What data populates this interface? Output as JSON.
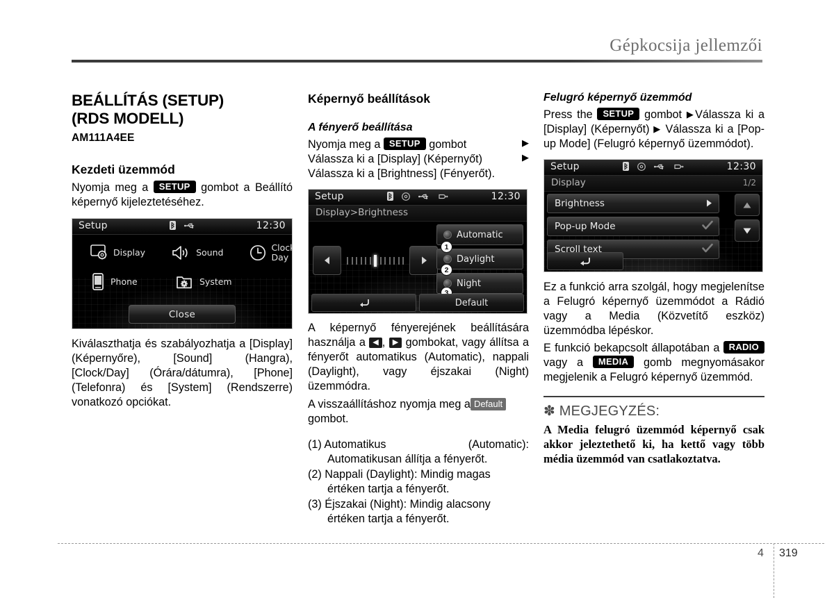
{
  "header": {
    "title": "Gépkocsija jellemzői"
  },
  "footer": {
    "chapter": "4",
    "page": "319"
  },
  "left": {
    "section_title_line1": "BEÁLLÍTÁS (SETUP)",
    "section_title_line2": "(RDS MODELL)",
    "code": "AM111A4EE",
    "subtitle": "Kezdeti üzemmód",
    "intro_before": "Nyomja meg a",
    "intro_pill": "SETUP",
    "intro_after": "gombot a Beállító képernyő kijeleztetéséhez.",
    "caption": "Kiválaszthatja és szabályozhatja a [Display] (Képernyőre), [Sound] (Hangra), [Clock/Day] (Órára/dátumra), [Phone] (Telefonra) és [System] (Rendszerre) vonatkozó opciókat.",
    "device": {
      "status_title": "Setup",
      "clock": "12:30",
      "icons": [
        "bluetooth-icon",
        "usb-icon"
      ],
      "menu": [
        {
          "label_line1": "Display",
          "label_line2": "",
          "icon": "display-gear-icon"
        },
        {
          "label_line1": "Sound",
          "label_line2": "",
          "icon": "speaker-icon"
        },
        {
          "label_line1": "Clock/",
          "label_line2": "Day",
          "icon": "clock-icon"
        },
        {
          "label_line1": "Phone",
          "label_line2": "",
          "icon": "phone-icon"
        },
        {
          "label_line1": "System",
          "label_line2": "",
          "icon": "folder-gear-icon"
        }
      ],
      "close_label": "Close"
    }
  },
  "mid": {
    "subtitle": "Képernyő beállítások",
    "italic_title": "A fényerő beállítása",
    "step_pre": "Nyomja meg a",
    "step_pill": "SETUP",
    "step_post": "gombot",
    "step2": "Válassza ki a [Display] (Képernyőt)",
    "step3": "Válassza ki a [Brightness] (Fényerőt).",
    "para1_a": "A képernyő fényerejének beállítására használja a",
    "para1_b": ",",
    "para1_c": "gombokat, vagy állítsa a fényerőt automatikus (Automatic), nappali (Daylight), vagy éjszakai (Night) üzemmódra.",
    "para2_a": "A visszaállításhoz nyomja meg a",
    "para2_pill": "Default",
    "para2_b": "gombot.",
    "list": [
      {
        "num": "(1)",
        "label": "Automatikus",
        "en": "(Automatic):",
        "desc": "Automatikusan állítja a fényerőt."
      },
      {
        "num": "(2)",
        "label": "Nappali (Daylight): Mindig magas",
        "en": "",
        "desc": "értéken tartja a fényerőt."
      },
      {
        "num": "(3)",
        "label": "Éjszakai (Night): Mindig alacsony",
        "en": "",
        "desc": "értéken tartja a fényerőt."
      }
    ],
    "device": {
      "status_title": "Setup",
      "clock": "12:30",
      "icons": [
        "bluetooth-icon",
        "disc-icon",
        "usb-icon",
        "aux-icon"
      ],
      "breadcrumb": "Display>Brightness",
      "options": [
        {
          "label": "Automatic",
          "callout": "1"
        },
        {
          "label": "Daylight",
          "callout": "2"
        },
        {
          "label": "Night",
          "callout": "3"
        }
      ],
      "slider_ticks": 13,
      "slider_active_index": 6,
      "back_label": "",
      "default_label": "Default"
    }
  },
  "right": {
    "italic_title": "Felugró képernyő üzemmód",
    "step_pre": "Press the",
    "step_pill": "SETUP",
    "step_post": "gombot",
    "step2": "Válassza ki a [Display] (Képernyőt)",
    "step3": "Válassza ki a [Pop-up Mode] (Felugró képernyő üzemmódot).",
    "para1": "Ez a funkció arra szolgál, hogy megjelenítse a Felugró képernyő üzemmódot a Rádió vagy a Media (Közvetítő eszköz) üzemmódba lépéskor.",
    "para2_a": "E funkció bekapcsolt állapotában a",
    "para2_pill1": "RADIO",
    "para2_b": "vagy a",
    "para2_pill2": "MEDIA",
    "para2_c": "gomb megnyomásakor megjelenik a Felugró képernyő üzemmód.",
    "note_head": "✽ MEGJEGYZÉS:",
    "note_body": "A Media felugró üzemmód képernyő csak akkor jeleztethető ki, ha kettő vagy több média üzemmód van csatlakoztatva.",
    "device": {
      "status_title": "Setup",
      "clock": "12:30",
      "icons": [
        "bluetooth-icon",
        "disc-icon",
        "usb-icon",
        "aux-icon"
      ],
      "breadcrumb": "Display",
      "page_indicator": "1/2",
      "rows": [
        {
          "label": "Brightness",
          "right_icon": "chevron-right-icon"
        },
        {
          "label": "Pop-up Mode",
          "right_icon": "check-icon"
        },
        {
          "label": "Scroll text",
          "right_icon": "check-icon"
        }
      ],
      "scroll_up": "chevron-up-icon",
      "scroll_down": "chevron-down-icon",
      "back_icon": "back-arrow-icon"
    }
  }
}
